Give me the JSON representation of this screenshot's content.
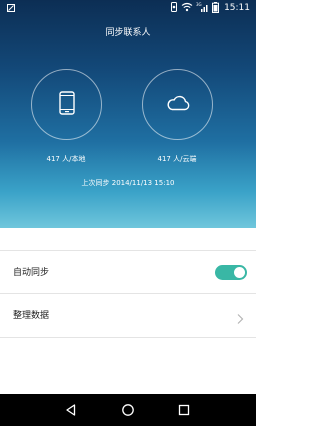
{
  "status_bar": {
    "time": "15:11",
    "network_label": "3G",
    "icons": [
      "screenshot-icon",
      "sync-status-icon",
      "wifi-icon",
      "signal-icon",
      "battery-icon"
    ]
  },
  "header": {
    "title": "同步联系人"
  },
  "local": {
    "icon": "phone-icon",
    "count_label": "417 人/本地"
  },
  "cloud": {
    "icon": "cloud-icon",
    "count_label": "417 人/云端"
  },
  "sync_info": {
    "last_sync": "上次同步 2014/11/13 15:10"
  },
  "settings": {
    "auto_sync": {
      "label": "自动同步",
      "enabled": true
    },
    "organize_data": {
      "label": "整理数据"
    }
  },
  "colors": {
    "toggle_on": "#39b7a5",
    "hero_top": "#0c2e54",
    "hero_bottom": "#6fc6dc"
  },
  "nav": {
    "icons": [
      "back-icon",
      "home-icon",
      "recent-apps-icon"
    ]
  }
}
